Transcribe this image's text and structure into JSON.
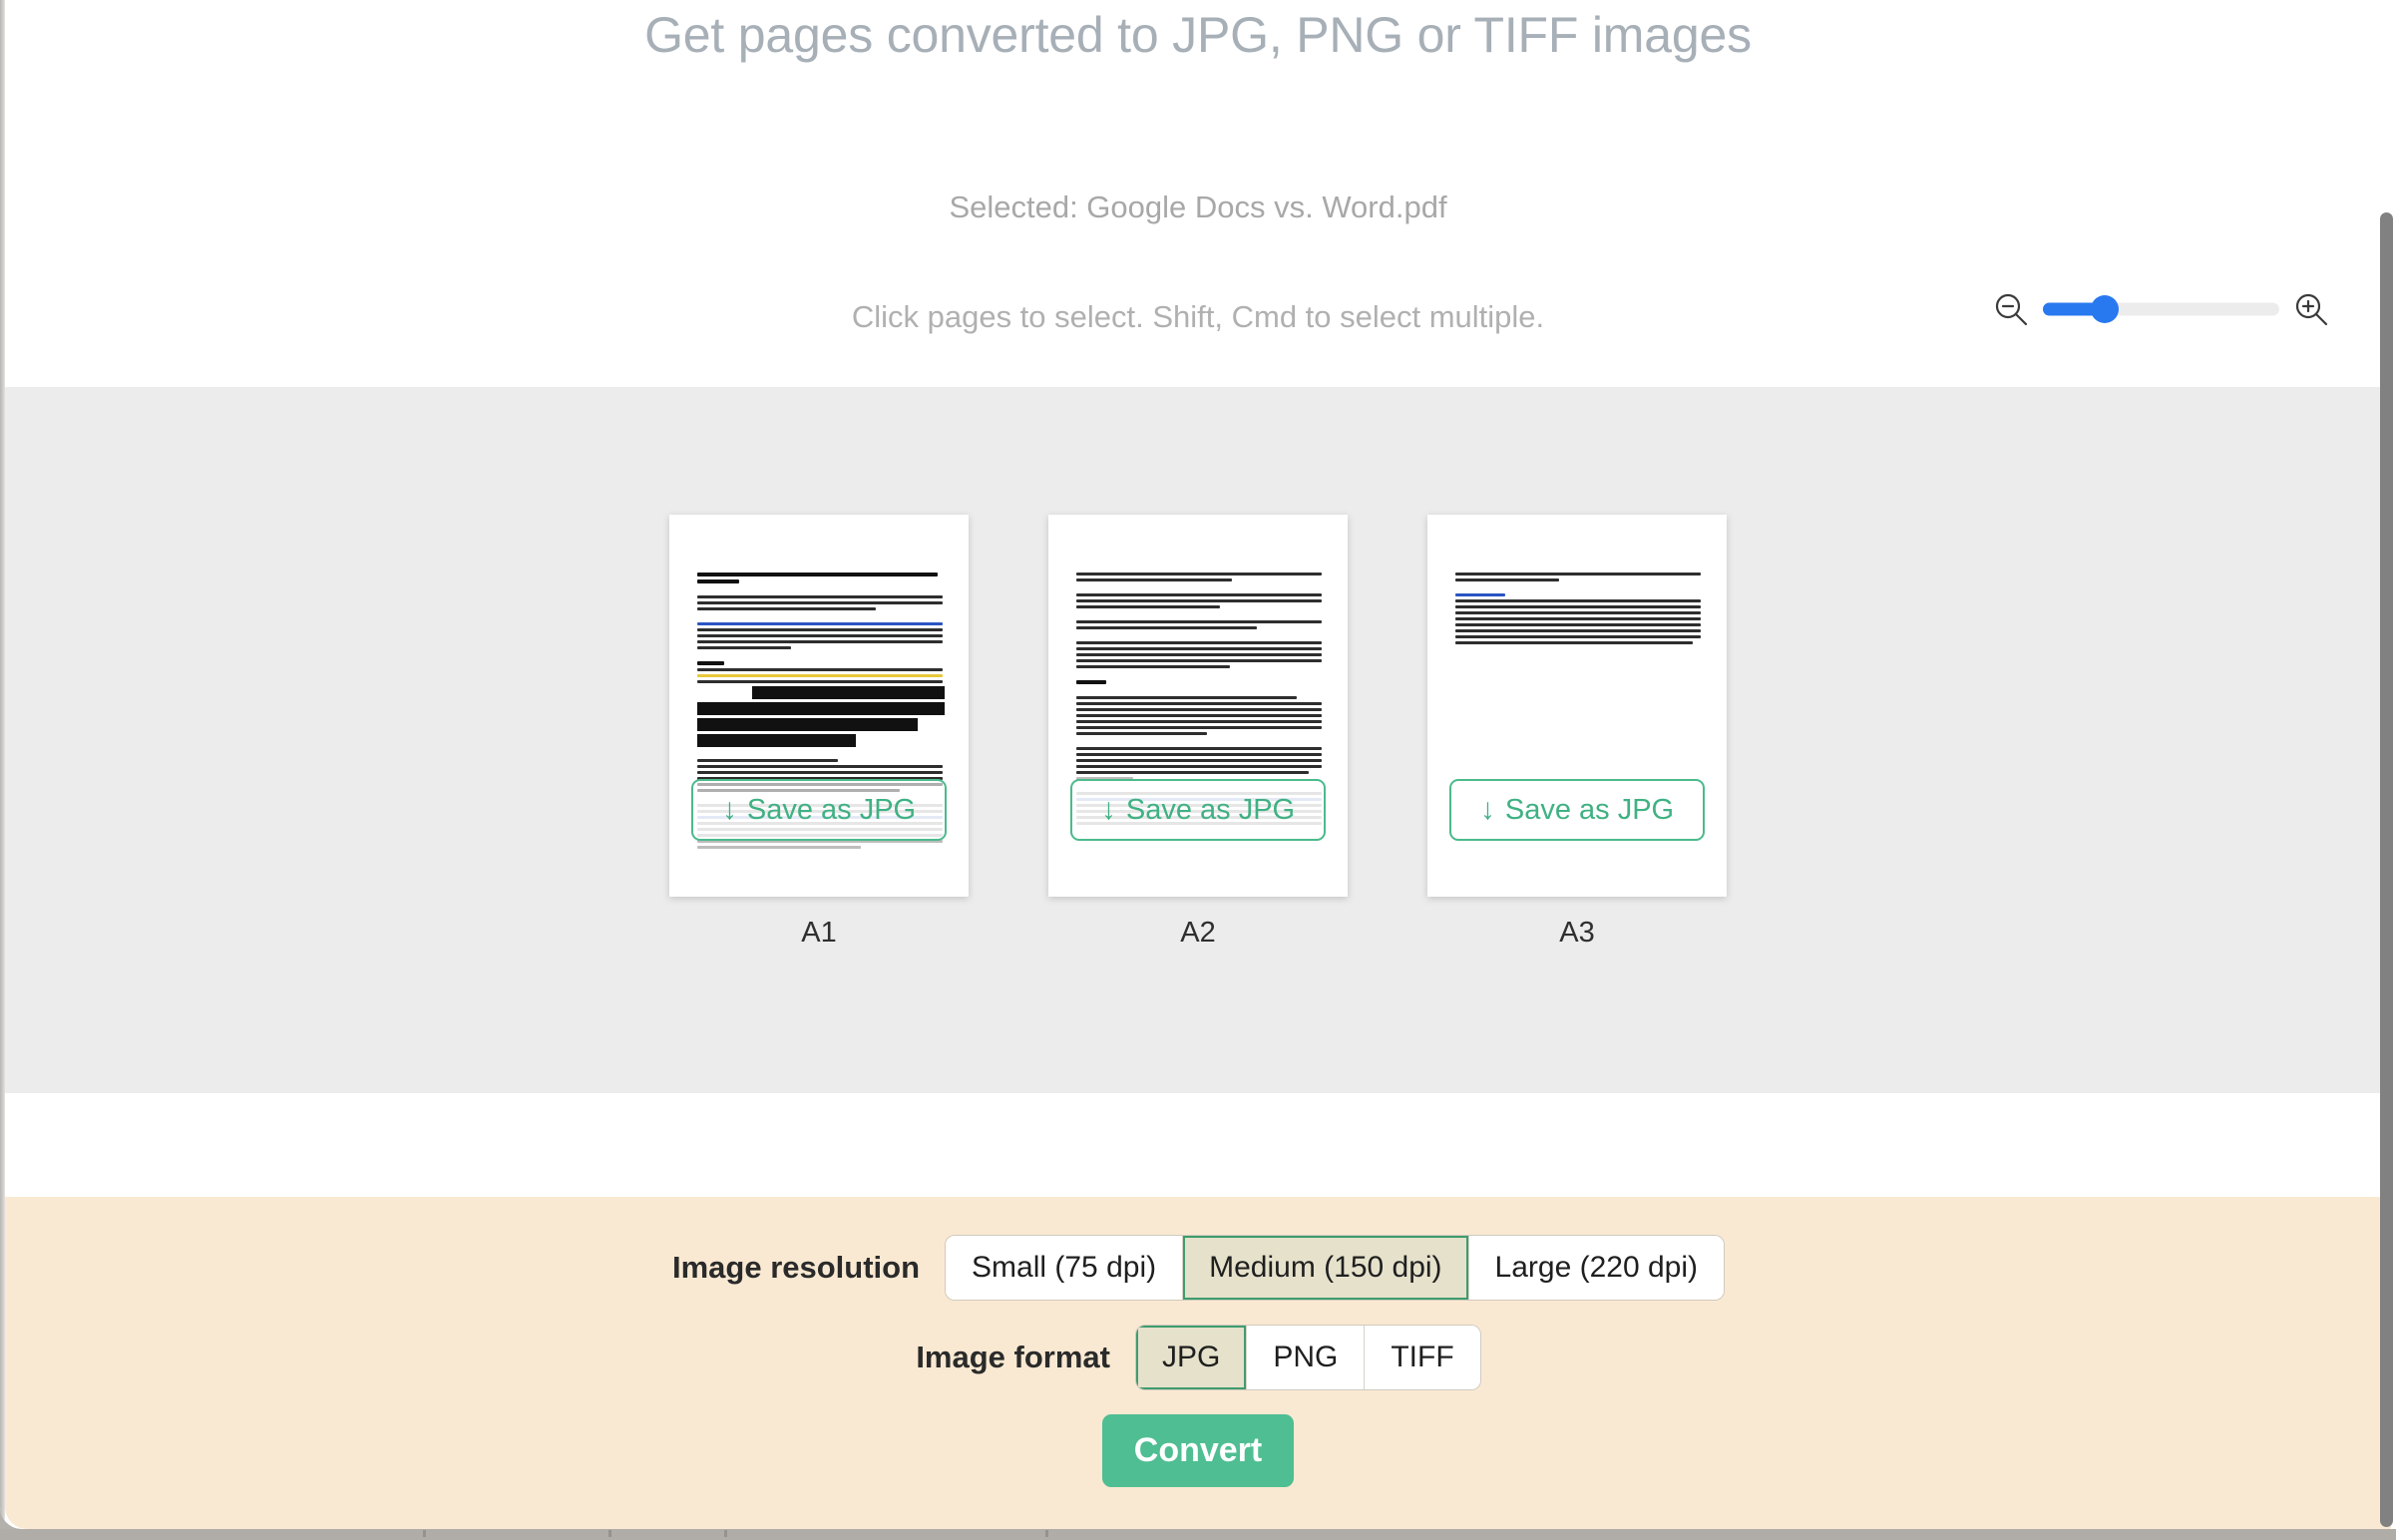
{
  "header": {
    "title": "Get pages converted to JPG, PNG or TIFF images",
    "selected_file": "Selected: Google Docs vs. Word.pdf",
    "hint": "Click pages to select. Shift, Cmd to select multiple."
  },
  "zoom_control": {
    "zoom_out_icon": "magnifier-minus-icon",
    "zoom_in_icon": "magnifier-plus-icon",
    "value_percent": 22
  },
  "pages": [
    {
      "label": "A1",
      "save_button": "Save as JPG",
      "arrow": "↓"
    },
    {
      "label": "A2",
      "save_button": "Save as JPG",
      "arrow": "↓"
    },
    {
      "label": "A3",
      "save_button": "Save as JPG",
      "arrow": "↓"
    }
  ],
  "options": {
    "resolution_label": "Image resolution",
    "resolution_options": [
      {
        "label": "Small (75 dpi)",
        "selected": false
      },
      {
        "label": "Medium (150 dpi)",
        "selected": true
      },
      {
        "label": "Large (220 dpi)",
        "selected": false
      }
    ],
    "format_label": "Image format",
    "format_options": [
      {
        "label": "JPG",
        "selected": true
      },
      {
        "label": "PNG",
        "selected": false
      },
      {
        "label": "TIFF",
        "selected": false
      }
    ],
    "convert_label": "Convert"
  },
  "colors": {
    "accent_green": "#4fbe92",
    "selected_fill": "#e5e1cb",
    "selected_border": "#3f9c6d",
    "panel_beige": "#fae9d2",
    "thumb_area_gray": "#ececec",
    "title_gray": "#a7afb7",
    "slider_blue": "#2878f0"
  }
}
